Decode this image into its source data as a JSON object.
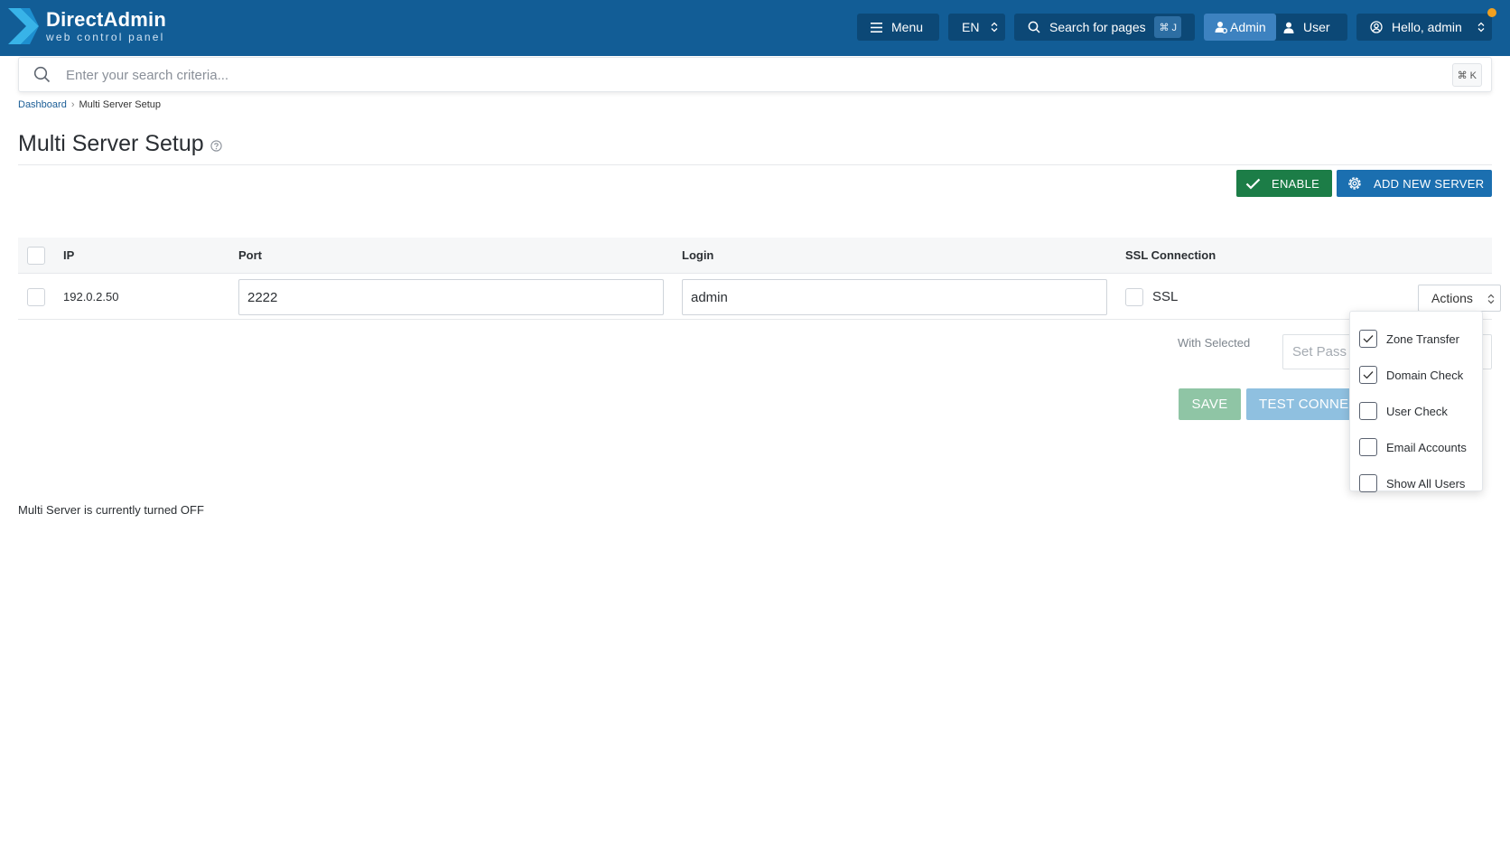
{
  "brand": {
    "name": "DirectAdmin",
    "subtitle": "web control panel"
  },
  "header": {
    "menu_label": "Menu",
    "lang_label": "EN",
    "search_pages_label": "Search for pages",
    "search_pages_shortcut": "⌘ J",
    "role_admin_label": "Admin",
    "role_user_label": "User",
    "hello_label": "Hello, admin"
  },
  "search": {
    "placeholder": "Enter your search criteria...",
    "shortcut": "⌘ K"
  },
  "breadcrumb": {
    "home": "Dashboard",
    "separator": "›",
    "current": "Multi Server Setup"
  },
  "page": {
    "title": "Multi Server Setup"
  },
  "toolbar": {
    "enable_label": "ENABLE",
    "add_server_label": "ADD NEW SERVER"
  },
  "table": {
    "headers": {
      "ip": "IP",
      "port": "Port",
      "login": "Login",
      "ssl": "SSL Connection"
    },
    "rows": [
      {
        "ip": "192.0.2.50",
        "port": "2222",
        "login": "admin",
        "ssl_label": "SSL",
        "ssl_checked": false,
        "actions_label": "Actions"
      }
    ]
  },
  "with_selected": {
    "label": "With Selected",
    "placeholder": "Set Pass"
  },
  "buttons": {
    "save_label": "SAVE",
    "test_label": "TEST CONNECTION"
  },
  "status_text": "Multi Server is currently turned OFF",
  "actions_dropdown": {
    "items": [
      {
        "label": "Zone Transfer",
        "checked": true
      },
      {
        "label": "Domain Check",
        "checked": true
      },
      {
        "label": "User Check",
        "checked": false
      },
      {
        "label": "Email Accounts",
        "checked": false
      },
      {
        "label": "Show All Users",
        "checked": false
      }
    ]
  },
  "colors": {
    "header_bg": "#125d96",
    "header_button_bg": "#0c4876",
    "role_active_bg": "#3d82c0",
    "enable_green": "#1c7d47",
    "primary_blue": "#1b6fb0",
    "notification": "#f0a020"
  }
}
